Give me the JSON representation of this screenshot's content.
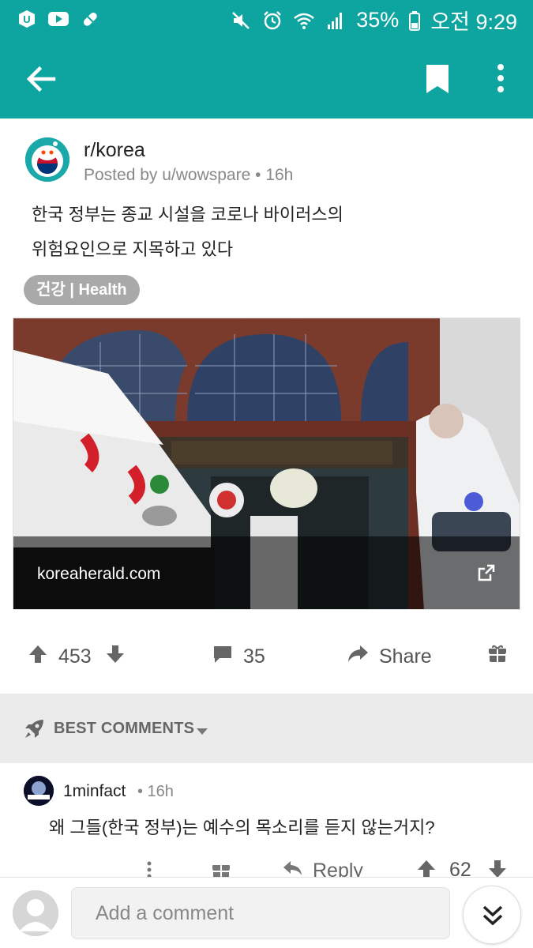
{
  "status_bar": {
    "battery": "35%",
    "time": "오전 9:29",
    "left_icons": [
      "app-icon",
      "youtube-icon",
      "pill-icon"
    ],
    "right_icons": [
      "mute-icon",
      "alarm-icon",
      "wifi-icon",
      "signal-icon",
      "battery-icon"
    ]
  },
  "app_bar": {
    "icons": [
      "back-arrow-icon",
      "bookmark-icon",
      "more-vertical-icon"
    ],
    "color": "#0ea5a0"
  },
  "post": {
    "subreddit": "r/korea",
    "meta": "Posted by u/wowspare • 16h",
    "title_line1": "한국 정부는 종교 시설을 코로나 바이러스의",
    "title_line2": "위험요인으로 지목하고 있다",
    "flair": "건강 | Health",
    "link_domain": "koreaherald.com",
    "upvotes": "453",
    "comments": "35",
    "share_label": "Share"
  },
  "best_comments": {
    "label": "BEST COMMENTS"
  },
  "comment": {
    "author": "1minfact",
    "age": "• 16h",
    "text": "왜 그들(한국 정부)는 예수의 목소리를 듣지 않는거지?",
    "reply_label": "Reply",
    "score": "62"
  },
  "composer": {
    "placeholder": "Add a comment"
  }
}
